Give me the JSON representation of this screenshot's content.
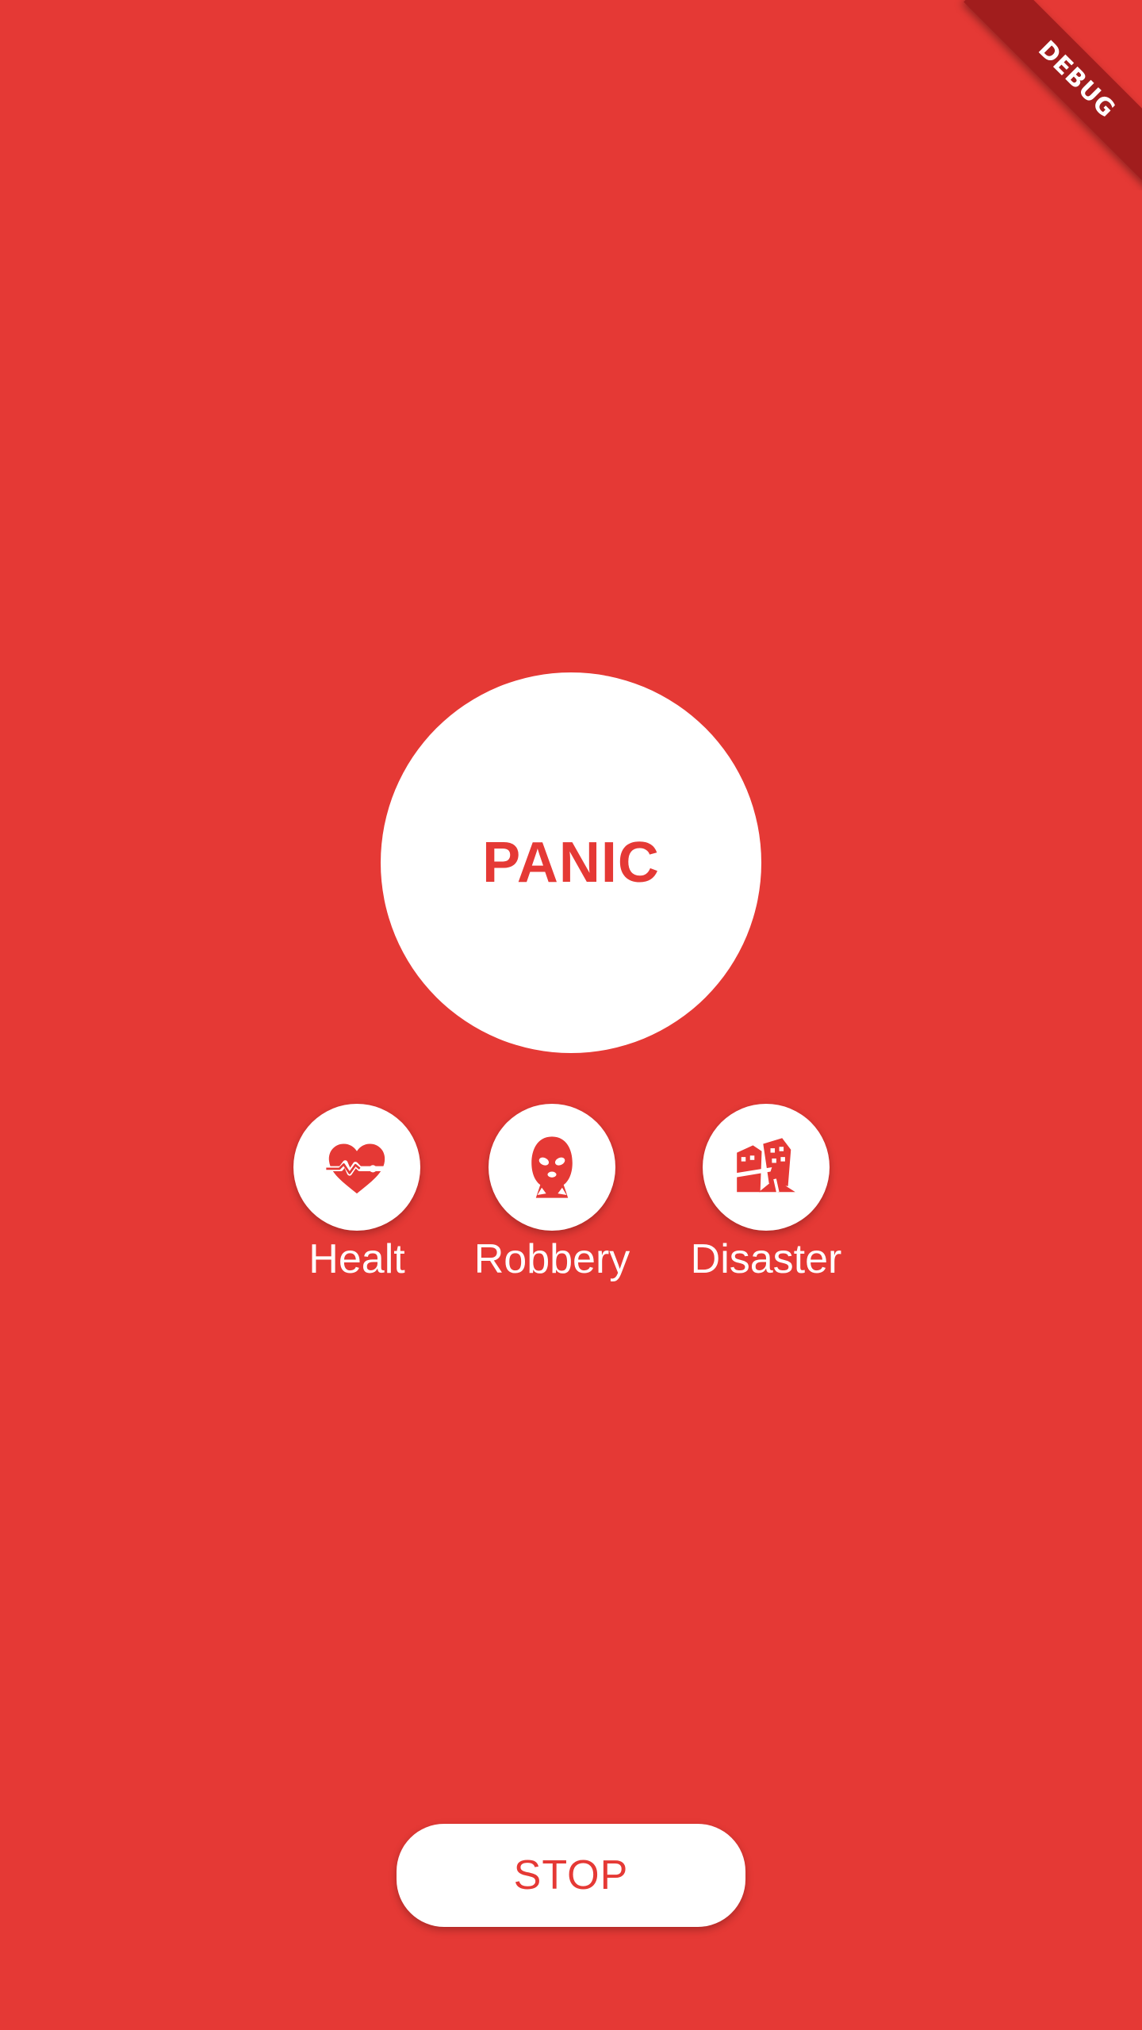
{
  "debug_banner": {
    "label": "DEBUG"
  },
  "panic": {
    "label": "PANIC"
  },
  "categories": [
    {
      "label": "Healt",
      "icon": "heart-pulse-icon"
    },
    {
      "label": "Robbery",
      "icon": "robber-mask-icon"
    },
    {
      "label": "Disaster",
      "icon": "collapsed-buildings-icon"
    }
  ],
  "stop": {
    "label": "STOP"
  },
  "colors": {
    "background": "#e53935",
    "accent": "#e53935",
    "surface": "#ffffff",
    "banner": "#a11d1d"
  }
}
